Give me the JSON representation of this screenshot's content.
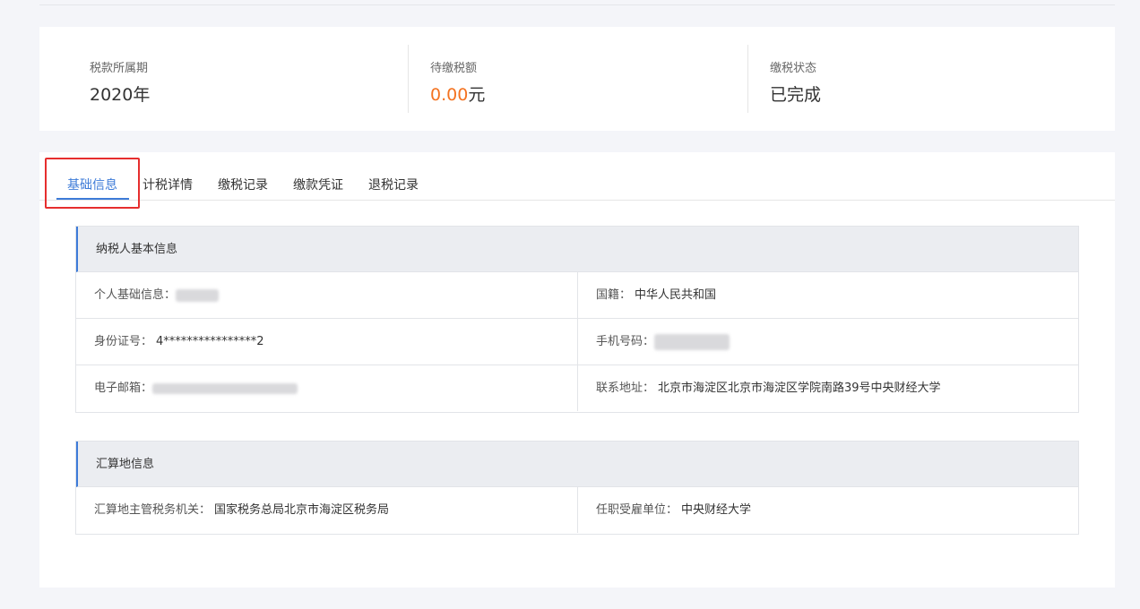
{
  "summary": {
    "period_label": "税款所属期",
    "period_value": "2020年",
    "due_label": "待缴税额",
    "due_amount": "0.00",
    "due_unit": "元",
    "status_label": "缴税状态",
    "status_value": "已完成"
  },
  "tabs": [
    {
      "label": "基础信息",
      "active": true
    },
    {
      "label": "计税详情",
      "active": false
    },
    {
      "label": "缴税记录",
      "active": false
    },
    {
      "label": "缴款凭证",
      "active": false
    },
    {
      "label": "退税记录",
      "active": false
    }
  ],
  "taxpayer": {
    "title": "纳税人基本信息",
    "personal_label": "个人基础信息：",
    "nationality_label": "国籍：",
    "nationality_value": "中华人民共和国",
    "id_label": "身份证号：",
    "id_value": "4****************2",
    "phone_label": "手机号码：",
    "email_label": "电子邮箱：",
    "address_label": "联系地址：",
    "address_value": "北京市海淀区北京市海淀区学院南路39号中央财经大学"
  },
  "settlement": {
    "title": "汇算地信息",
    "authority_label": "汇算地主管税务机关：",
    "authority_value": "国家税务总局北京市海淀区税务局",
    "employer_label": "任职受雇单位：",
    "employer_value": "中央财经大学"
  },
  "colors": {
    "accent": "#3d7bd8",
    "amount": "#f47321",
    "status_done": "#35b561",
    "highlight": "#e62e2e"
  }
}
